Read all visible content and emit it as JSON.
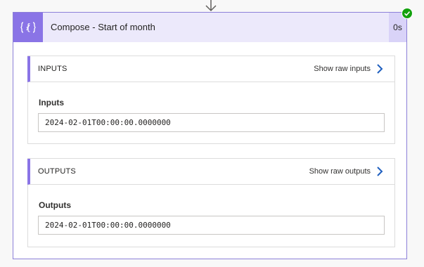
{
  "action": {
    "title": "Compose - Start of month",
    "duration": "0s",
    "status": "succeeded",
    "icon": "braces-icon",
    "accent_color": "#8a74e6",
    "success_color": "#13a10e",
    "link_color": "#1f5fbf"
  },
  "inputs": {
    "section_label": "INPUTS",
    "raw_link": "Show raw inputs",
    "field_label": "Inputs",
    "value": "2024-02-01T00:00:00.0000000"
  },
  "outputs": {
    "section_label": "OUTPUTS",
    "raw_link": "Show raw outputs",
    "field_label": "Outputs",
    "value": "2024-02-01T00:00:00.0000000"
  }
}
